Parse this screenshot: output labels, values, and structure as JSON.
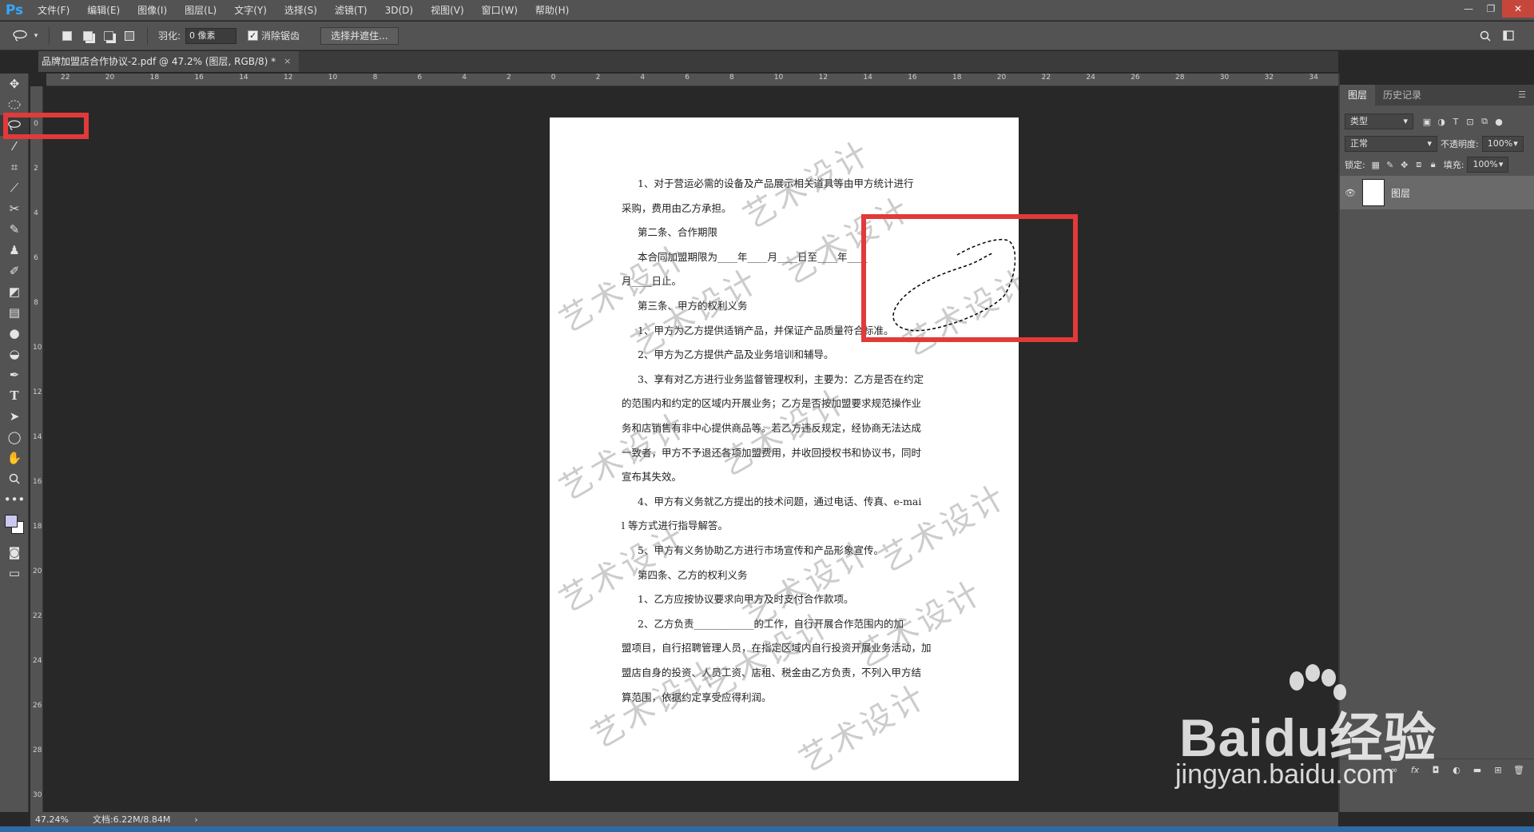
{
  "app": {
    "logo": "Ps"
  },
  "menu": [
    "文件(F)",
    "编辑(E)",
    "图像(I)",
    "图层(L)",
    "文字(Y)",
    "选择(S)",
    "滤镜(T)",
    "3D(D)",
    "视图(V)",
    "窗口(W)",
    "帮助(H)"
  ],
  "window_controls": {
    "minimize": "—",
    "restore": "❐",
    "close": "✕"
  },
  "options": {
    "feather_label": "羽化:",
    "feather_value": "0 像素",
    "antialias_label": "消除锯齿",
    "antialias_checked": "✓",
    "select_mask_button": "选择并遮住..."
  },
  "document_tab": {
    "title": "品牌加盟店合作协议-2.pdf @ 47.2% (图层, RGB/8) *",
    "close": "×"
  },
  "ruler_top_ticks": [
    "22",
    "20",
    "18",
    "16",
    "14",
    "12",
    "10",
    "8",
    "6",
    "4",
    "2",
    "0",
    "2",
    "4",
    "6",
    "8",
    "10",
    "12",
    "14",
    "16",
    "18",
    "20",
    "22",
    "24",
    "26",
    "28",
    "30",
    "32",
    "34"
  ],
  "ruler_left_ticks": [
    "0",
    "2",
    "4",
    "6",
    "8",
    "10",
    "12",
    "14",
    "16",
    "18",
    "20",
    "22",
    "24",
    "26",
    "28",
    "30"
  ],
  "document": {
    "lines": [
      "1、对于营运必需的设备及产品展示相关道具等由甲方统计进行",
      "采购，费用由乙方承担。",
      "第二条、合作期限",
      "本合同加盟期限为____年____月____日至____年____",
      "月____日止。",
      "第三条、甲方的权利义务",
      "1、甲方为乙方提供适销产品，并保证产品质量符合标准。",
      "2、甲方为乙方提供产品及业务培训和辅导。",
      "3、享有对乙方进行业务监督管理权利，主要为：乙方是否在约定",
      "的范围内和约定的区域内开展业务；乙方是否按加盟要求规范操作业",
      "务和店销售有非中心提供商品等。若乙方违反规定，经协商无法达成",
      "一致者，甲方不予退还各项加盟费用，并收回授权书和协议书，同时",
      "宣布其失效。",
      "4、甲方有义务就乙方提出的技术问题，通过电话、传真、e-mai",
      "l 等方式进行指导解答。",
      "5、甲方有义务协助乙方进行市场宣传和产品形象宣传。",
      "第四条、乙方的权利义务",
      "1、乙方应按协议要求向甲方及时支付合作款项。",
      "2、乙方负责____________的工作，自行开展合作范围内的加",
      "盟项目，自行招聘管理人员，在指定区域内自行投资开展业务活动，加",
      "盟店自身的投资、人员工资、店租、税金由乙方负责，不列入甲方结",
      "算范围，依据约定享受应得利润。"
    ],
    "watermark": "艺术设计"
  },
  "panel": {
    "tabs": [
      "图层",
      "历史记录"
    ],
    "filter_kind": "类型",
    "blend_mode": "正常",
    "opacity_label": "不透明度:",
    "opacity_value": "100%",
    "lock_label": "锁定:",
    "fill_label": "填充:",
    "fill_value": "100%",
    "layer_name": "图层"
  },
  "status": {
    "zoom": "47.24%",
    "doc_size": "文档:6.22M/8.84M"
  },
  "baidu": {
    "brand": "Baidu经验",
    "url": "jingyan.baidu.com"
  },
  "colors": {
    "highlight": "#e23a3a",
    "ps_blue": "#31a8ff"
  }
}
